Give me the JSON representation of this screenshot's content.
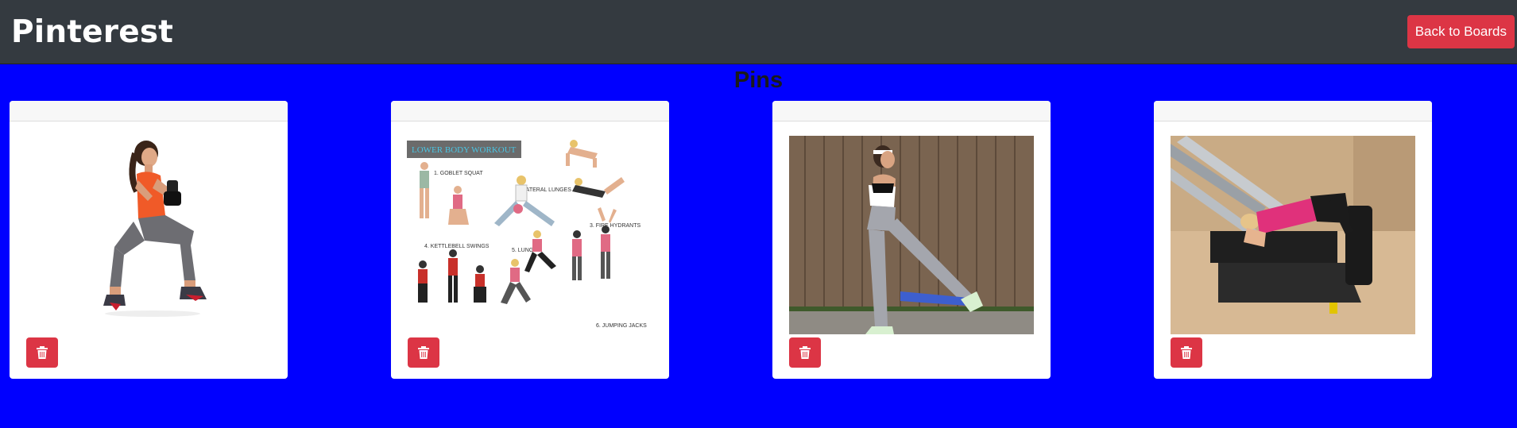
{
  "navbar": {
    "brand": "Pinterest",
    "back_button": "Back to Boards"
  },
  "page": {
    "title": "Pins"
  },
  "pins": [
    {
      "name": "goblet-squat-pin",
      "image": "woman-goblet-squat-with-kettlebell",
      "delete_icon": "trash-icon"
    },
    {
      "name": "lower-body-workout-pin",
      "image": "lower-body-workout-infographic",
      "delete_icon": "trash-icon",
      "infographic": {
        "title": "LOWER BODY WORKOUT",
        "items": [
          "1. GOBLET SQUAT",
          "2. LATERAL LUNGES",
          "3. FIRE HYDRANTS",
          "4. KETTLEBELL SWINGS",
          "5. LUNGES",
          "6. JUMPING JACKS"
        ]
      }
    },
    {
      "name": "resistance-band-kickback-pin",
      "image": "woman-resistance-band-kickback",
      "delete_icon": "trash-icon"
    },
    {
      "name": "reformer-machine-pin",
      "image": "woman-on-reformer-machine",
      "delete_icon": "trash-icon"
    }
  ],
  "colors": {
    "page_background": "#0000ff",
    "navbar": "#343a40",
    "danger": "#dc3545"
  }
}
